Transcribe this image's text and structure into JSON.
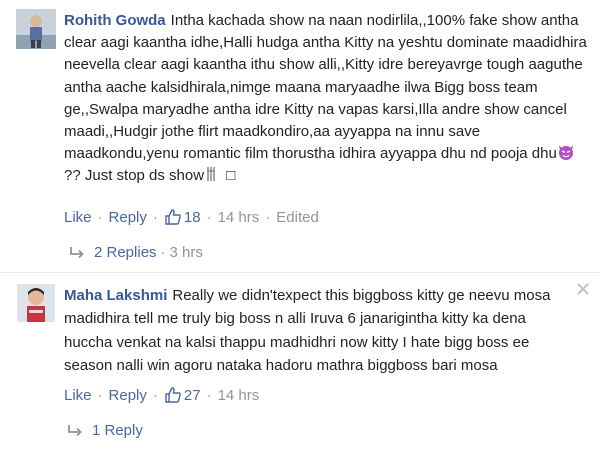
{
  "comments": [
    {
      "author": "Rohith Gowda",
      "text": "Intha kachada show na naan nodirlila,,100% fake show antha clear aagi kaantha idhe,Halli hudga antha Kitty na yeshtu dominate maadidhira neevella clear aagi kaantha ithu show alli,,Kitty idre bereyavrge tough aaguthe antha aache kalsidhirala,nimge maana maryaadhe ilwa Bigg boss team ge,,Swalpa maryadhe antha idre Kitty na vapas karsi,Illa andre show cancel maadi,,Hudgir jothe flirt maadkondiro,aa ayyappa na innu save maadkondu,yenu romantic film thorustha idhira ayyappa dhu nd pooja dhu",
      "text_tail": "?? Just stop ds show",
      "text_tail_box": "□",
      "actions": {
        "like": "Like",
        "reply": "Reply",
        "like_count": "18",
        "time": "14 hrs",
        "edited": "Edited"
      },
      "replies": {
        "label": "2 Replies",
        "time": "3 hrs"
      },
      "icons": [
        "devil-emoji",
        "scissors-emoji"
      ]
    },
    {
      "author": "Maha Lakshmi",
      "text": "Really we didn'texpect this biggboss kitty ge neevu mosa madidhira tell me truly big boss n alli Iruva 6 janarigintha kitty ka dena huccha venkat na kalsi thappu madhidhri now kitty I hate bigg boss ee season nalli win agoru nataka hadoru mathra biggboss bari mosa",
      "actions": {
        "like": "Like",
        "reply": "Reply",
        "like_count": "27",
        "time": "14 hrs"
      },
      "replies": {
        "label": "1 Reply"
      }
    }
  ],
  "colors": {
    "name": "#365899",
    "link": "#4b67a1",
    "meta": "#90949c",
    "text": "#1d2129"
  }
}
